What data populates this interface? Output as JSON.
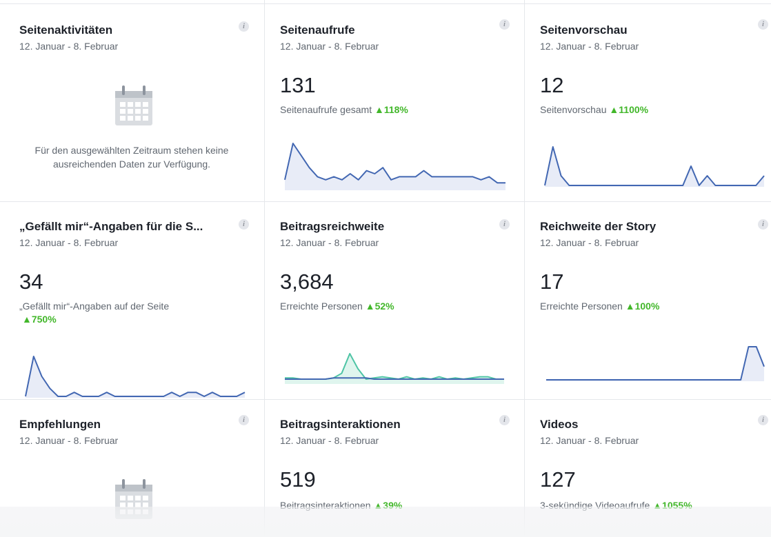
{
  "date_range": "12. Januar - 8. Februar",
  "info_glyph": "i",
  "cards": {
    "seitenaktivitaeten": {
      "title": "Seitenaktivitäten",
      "nodata": "Für den ausgewählten Zeitraum stehen keine ausreichenden Daten zur Verfügung."
    },
    "seitenaufrufe": {
      "title": "Seitenaufrufe",
      "value": "131",
      "label": "Seitenaufrufe gesamt",
      "change": "▲118%"
    },
    "seitenvorschau": {
      "title": "Seitenvorschau",
      "value": "12",
      "label": "Seitenvorschau",
      "change": "▲1100%"
    },
    "gefaellt_mir": {
      "title": "„Gefällt mir“-Angaben für die S...",
      "value": "34",
      "label": "„Gefällt mir“-Angaben auf der Seite",
      "change": "▲750%"
    },
    "beitragsreichweite": {
      "title": "Beitragsreichweite",
      "value": "3,684",
      "label": "Erreichte Personen",
      "change": "▲52%"
    },
    "story": {
      "title": "Reichweite der Story",
      "value": "17",
      "label": "Erreichte Personen",
      "change": "▲100%"
    },
    "empfehlungen": {
      "title": "Empfehlungen"
    },
    "interaktionen": {
      "title": "Beitragsinteraktionen",
      "value": "519",
      "label": "Beitragsinteraktionen",
      "change": "▲39%"
    },
    "videos": {
      "title": "Videos",
      "value": "127",
      "label": "3-sekündige Videoaufrufe",
      "change": "▲1055%"
    }
  },
  "colors": {
    "line_blue": "#4267b2",
    "fill_blue": "#e8ecf7",
    "line_teal": "#4ec4a5",
    "fill_teal": "#dff5ee",
    "positive": "#42b72a"
  },
  "icons": {
    "info": "info-icon",
    "calendar": "calendar-icon"
  },
  "chart_data": [
    {
      "type": "area",
      "name": "seitenaufrufe-spark",
      "values": [
        3,
        15,
        11,
        7,
        4,
        3,
        4,
        3,
        5,
        3,
        6,
        5,
        7,
        3,
        4,
        4,
        4,
        6,
        4,
        4,
        4,
        4,
        4,
        4,
        3,
        4,
        2,
        2
      ]
    },
    {
      "type": "area",
      "name": "seitenvorschau-spark",
      "values": [
        0,
        4,
        1,
        0,
        0,
        0,
        0,
        0,
        0,
        0,
        0,
        0,
        0,
        0,
        0,
        0,
        0,
        0,
        2,
        0,
        1,
        0,
        0,
        0,
        0,
        0,
        0,
        1
      ]
    },
    {
      "type": "area",
      "name": "gefaellt-mir-spark",
      "values": [
        0,
        10,
        5,
        2,
        0,
        0,
        1,
        0,
        0,
        0,
        1,
        0,
        0,
        0,
        0,
        0,
        0,
        0,
        1,
        0,
        1,
        1,
        0,
        1,
        0,
        0,
        0,
        1
      ]
    },
    {
      "type": "area",
      "name": "beitragsreichweite-spark",
      "series": [
        {
          "name": "organic",
          "values": [
            3,
            3,
            3,
            3,
            3,
            3,
            4,
            4,
            4,
            4,
            4,
            3,
            3,
            3,
            3,
            3,
            3,
            3,
            3,
            3,
            3,
            3,
            3,
            3,
            3,
            3,
            3,
            3
          ]
        },
        {
          "name": "paid",
          "values": [
            4,
            4,
            3,
            3,
            3,
            3,
            4,
            8,
            25,
            12,
            3,
            4,
            5,
            4,
            3,
            5,
            3,
            4,
            3,
            5,
            3,
            4,
            3,
            4,
            5,
            5,
            3,
            3
          ]
        }
      ]
    },
    {
      "type": "area",
      "name": "story-spark",
      "values": [
        0,
        0,
        0,
        0,
        0,
        0,
        0,
        0,
        0,
        0,
        0,
        0,
        0,
        0,
        0,
        0,
        0,
        0,
        0,
        0,
        0,
        0,
        0,
        0,
        0,
        0,
        5,
        5,
        2
      ]
    }
  ]
}
